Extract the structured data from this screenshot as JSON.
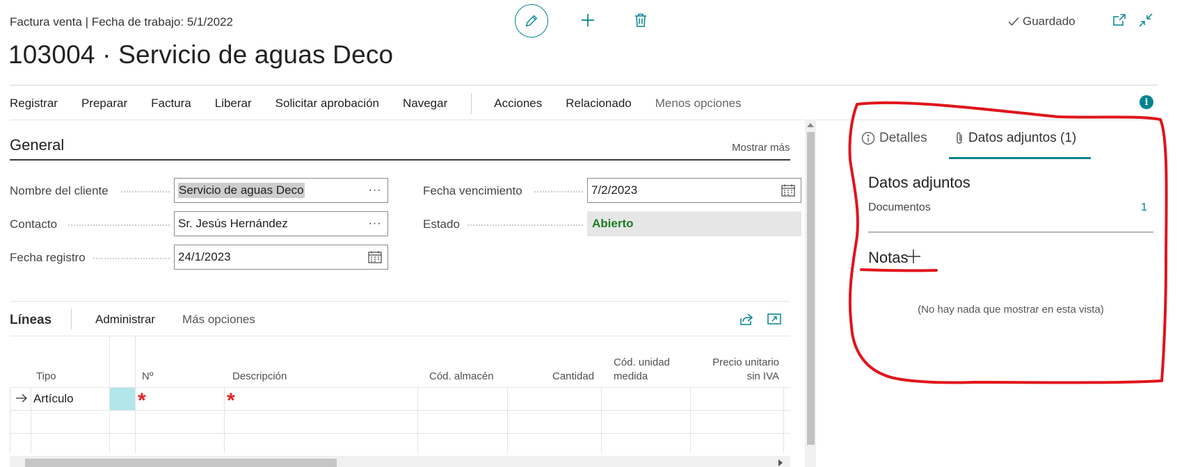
{
  "header": {
    "subtitle": "Factura venta | Fecha de trabajo: 5/1/2022",
    "title": "103004 · Servicio de aguas Deco",
    "saved_status": "Guardado"
  },
  "actions": {
    "register": "Registrar",
    "prepare": "Preparar",
    "invoice": "Factura",
    "release": "Liberar",
    "request_approval": "Solicitar aprobación",
    "navigate": "Navegar",
    "actions": "Acciones",
    "related": "Relacionado",
    "fewer_options": "Menos opciones"
  },
  "general": {
    "title": "General",
    "show_more": "Mostrar más",
    "fields": {
      "customer_name": {
        "label": "Nombre del cliente",
        "value": "Servicio de aguas Deco"
      },
      "contact": {
        "label": "Contacto",
        "value": "Sr. Jesús Hernández"
      },
      "posting_date": {
        "label": "Fecha registro",
        "value": "24/1/2023"
      },
      "due_date": {
        "label": "Fecha vencimiento",
        "value": "7/2/2023"
      },
      "status": {
        "label": "Estado",
        "value": "Abierto"
      }
    }
  },
  "lines": {
    "title": "Líneas",
    "manage": "Administrar",
    "more_options": "Más opciones",
    "columns": {
      "type": "Tipo",
      "no": "Nº",
      "description": "Descripción",
      "location": "Cód. almacén",
      "quantity": "Cantidad",
      "uom_1": "Cód. unidad",
      "uom_2": "medida",
      "price_1": "Precio unitario",
      "price_2": "sin IVA"
    },
    "rows": [
      {
        "type": "Artículo"
      }
    ]
  },
  "factbox": {
    "tab_details": "Detalles",
    "tab_attachments": "Datos adjuntos (1)",
    "attachments_heading": "Datos adjuntos",
    "documents_label": "Documentos",
    "documents_count": "1",
    "notes_heading": "Notas",
    "notes_empty": "(No hay nada que mostrar en esta vista)"
  },
  "colors": {
    "accent": "#00838f",
    "status_green": "#1b7d22",
    "required_red": "#e02424",
    "annotation_red": "#e0141b"
  }
}
